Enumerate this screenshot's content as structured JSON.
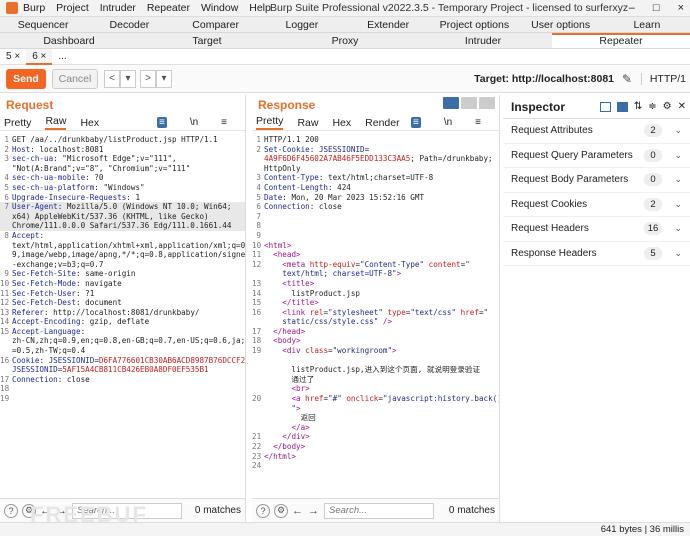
{
  "window": {
    "menus": [
      "Burp",
      "Project",
      "Intruder",
      "Repeater",
      "Window",
      "Help"
    ],
    "title": "Burp Suite Professional v2022.3.5 - Temporary Project - licensed to surferxyz",
    "controls": [
      "–",
      "□",
      "×"
    ]
  },
  "tabs_row1": [
    "Sequencer",
    "Decoder",
    "Comparer",
    "Logger",
    "Extender",
    "Project options",
    "User options",
    "Learn"
  ],
  "tabs_row2": [
    "Dashboard",
    "Target",
    "Proxy",
    "Intruder",
    "Repeater"
  ],
  "repeater_tabs": [
    "5 ×",
    "6 ×",
    "..."
  ],
  "toolbar": {
    "send": "Send",
    "cancel": "Cancel",
    "target": "Target: http://localhost:8081",
    "http": "HTTP/1"
  },
  "request": {
    "title": "Request",
    "tabs": [
      "Pretty",
      "Raw",
      "Hex"
    ],
    "icon_label": "\\n",
    "footer_search": "Search...",
    "matches": "0 matches"
  },
  "response": {
    "title": "Response",
    "tabs": [
      "Pretty",
      "Raw",
      "Hex",
      "Render"
    ],
    "icon_label": "\\n",
    "footer_search": "Search...",
    "matches": "0 matches"
  },
  "inspector": {
    "title": "Inspector",
    "rows": [
      {
        "label": "Request Attributes",
        "count": "2"
      },
      {
        "label": "Request Query Parameters",
        "count": "0"
      },
      {
        "label": "Request Body Parameters",
        "count": "0"
      },
      {
        "label": "Request Cookies",
        "count": "2"
      },
      {
        "label": "Request Headers",
        "count": "16"
      },
      {
        "label": "Response Headers",
        "count": "5"
      }
    ]
  },
  "status": "641 bytes | 36 millis",
  "watermark": "FREEBUF"
}
